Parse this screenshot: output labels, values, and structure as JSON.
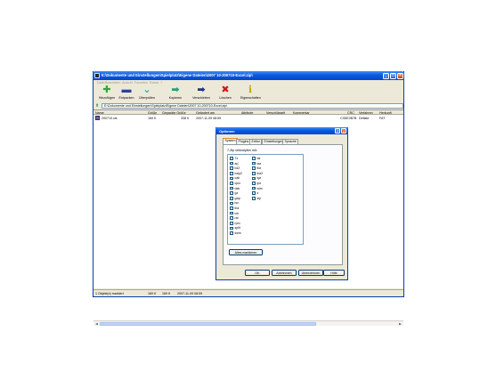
{
  "window": {
    "title": "E:\\Dokumente und Einstellungen\\Spielplatz\\Eigene Dateien\\2007 10-200710-Excel.zip\\"
  },
  "menu": [
    "Datei",
    "Bearbeiten",
    "Ansicht",
    "Favoriten",
    "Extras",
    "?"
  ],
  "toolbar": [
    {
      "label": "Hinzufügen",
      "icon": "plus-icon",
      "glyph": "✚",
      "color": "#2fa82f"
    },
    {
      "label": "Entpacken",
      "icon": "minus-icon",
      "glyph": "▬",
      "color": "#2b3f9e"
    },
    {
      "label": "Überprüfen",
      "icon": "check-icon",
      "glyph": "⌄",
      "color": "#2aa6a0"
    },
    {
      "label": "Kopieren",
      "icon": "arrow-right-green-icon",
      "glyph": "➡",
      "color": "#24a07a"
    },
    {
      "label": "Verschieben",
      "icon": "arrow-right-blue-icon",
      "glyph": "➡",
      "color": "#1d2f8f"
    },
    {
      "label": "Löschen",
      "icon": "delete-x-icon",
      "glyph": "✖",
      "color": "#d01818"
    },
    {
      "label": "Eigenschaften",
      "icon": "info-icon",
      "glyph": "ℹ",
      "color": "#c9a400"
    }
  ],
  "address": {
    "value": "E:\\Dokumente und Einstellungen\\Spielplatz\\Eigene Dateien\\2007 10-200710-Excel.zip\\"
  },
  "columns": [
    "Name",
    "Größe",
    "Gepackte Größe",
    "Geändert am",
    "Attribute",
    "Verschlüsselt",
    "Kommentar",
    "CRC",
    "Verfahren",
    "Herkunft"
  ],
  "files": [
    {
      "name": "200710.xls",
      "size": "169 K",
      "packed": "338 K",
      "modified": "2007-11-09 08:59",
      "attributes": "",
      "encrypted": "",
      "comment": "",
      "crc": "C3DE2B7B",
      "method": "Deflate",
      "origin": "FAT"
    }
  ],
  "status": {
    "selection": "1 Objekt(e) markiert",
    "size": "169 K",
    "packed": "169 K",
    "modified": "2007-11-09 08:59"
  },
  "dialog": {
    "title": "Optionen",
    "tabs": [
      "System",
      "Plugins",
      "Editor",
      "Einstellungen",
      "Sprache"
    ],
    "active_tab": "System",
    "assoc_label": "7-Zip verknüpfen mit:",
    "extensions_col1": [
      "7z",
      "arj",
      "bz2",
      "bzip2",
      "cab",
      "cpio",
      "deb",
      "gz",
      "gzip",
      "iso",
      "lha",
      "lzh",
      "rar",
      "rpm",
      "split",
      "swm"
    ],
    "extensions_col2": [
      "tar",
      "taz",
      "tbz",
      "tbz2",
      "tgz",
      "tpz",
      "wim",
      "z",
      "zip"
    ],
    "select_all": "Alles markieren",
    "buttons": {
      "ok": "OK",
      "cancel": "Abbrechen",
      "apply": "Übernehmen",
      "help": "Hilfe"
    }
  }
}
